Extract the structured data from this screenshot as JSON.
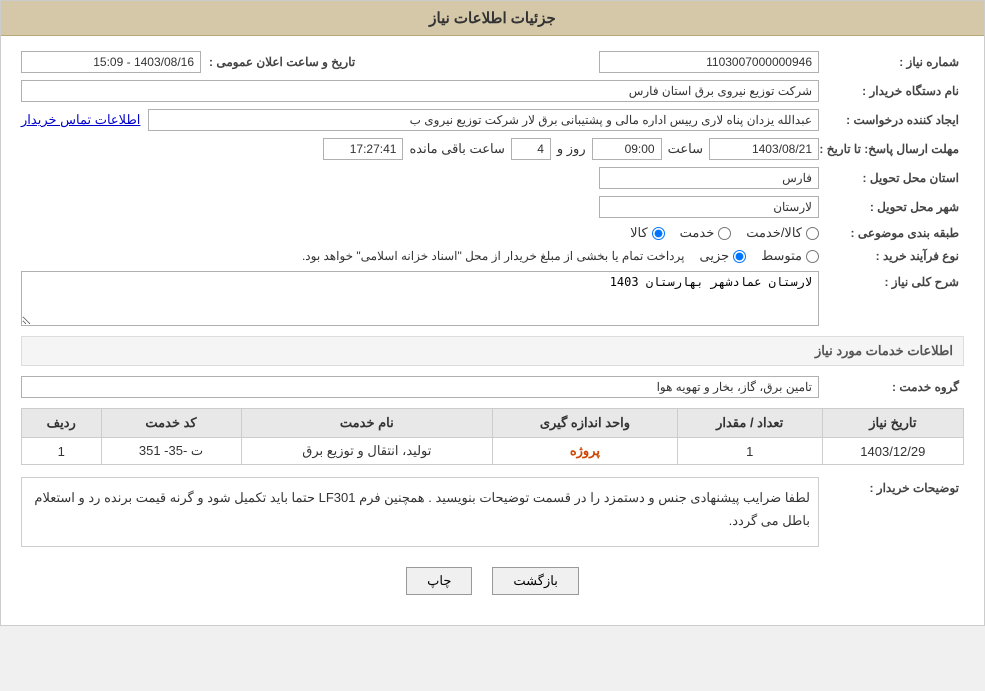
{
  "header": {
    "title": "جزئیات اطلاعات نیاز"
  },
  "fields": {
    "shomare_niaz_label": "شماره نیاز :",
    "shomare_niaz_value": "1103007000000946",
    "nam_dastgah_label": "نام دستگاه خریدار :",
    "nam_dastgah_value": "شرکت توزیع نیروی برق استان فارس",
    "ejad_label": "ایجاد کننده درخواست :",
    "ejad_value": "عبدالله یزدان پناه لاری رییس اداره مالی و پشتیبانی برق لار شرکت توزیع نیروی ب",
    "ejad_link": "اطلاعات تماس خریدار",
    "mohlat_label": "مهلت ارسال پاسخ: تا تاریخ :",
    "mohlat_date": "1403/08/21",
    "mohlat_saat_label": "ساعت",
    "mohlat_saat": "09:00",
    "mohlat_roz_label": "روز و",
    "mohlat_roz": "4",
    "mohlat_remaining_label": "ساعت باقی مانده",
    "mohlat_remaining": "17:27:41",
    "ostan_label": "استان محل تحویل :",
    "ostan_value": "فارس",
    "shahr_label": "شهر محل تحویل :",
    "shahr_value": "لارستان",
    "tabaghebandi_label": "طبقه بندی موضوعی :",
    "radio_kala": "کالا",
    "radio_khedmat": "خدمت",
    "radio_kala_khedmat": "کالا/خدمت",
    "nav_label": "نوع فرآیند خرید :",
    "radio_jozi": "جزیی",
    "radio_motavaset": "متوسط",
    "nav_desc": "پرداخت تمام یا بخشی از مبلغ خریدار از محل \"اسناد خزانه اسلامی\" خواهد بود.",
    "sharh_label": "شرح کلی نیاز :",
    "sharh_value": "لارستان عمادشهر بهارستان 1403",
    "khedamat_section": "اطلاعات خدمات مورد نیاز",
    "grooh_label": "گروه خدمت :",
    "grooh_value": "تامین برق، گاز، بخار و تهویه هوا",
    "table": {
      "headers": [
        "ردیف",
        "کد خدمت",
        "نام خدمت",
        "واحد اندازه گیری",
        "تعداد / مقدار",
        "تاریخ نیاز"
      ],
      "rows": [
        {
          "radif": "1",
          "kod": "ت -35- 351",
          "name": "تولید، انتقال و توزیع برق",
          "vahed": "پروژه",
          "tedad": "1",
          "tarikh": "1403/12/29"
        }
      ]
    },
    "tawzihat_label": "توضیحات خریدار :",
    "tawzihat_value": "لطفا ضرایب پیشنهادی جنس و دستمزد را در قسمت توضیحات بنویسید . همچنین فرم LF301 حتما باید تکمیل شود و گرنه قیمت برنده رد و استعلام باطل می گردد.",
    "btn_bazgasht": "بازگشت",
    "btn_chap": "چاپ",
    "date_range": "1403/08/16 - 15:09",
    "date_range_label": "تاریخ و ساعت اعلان عمومی :"
  }
}
